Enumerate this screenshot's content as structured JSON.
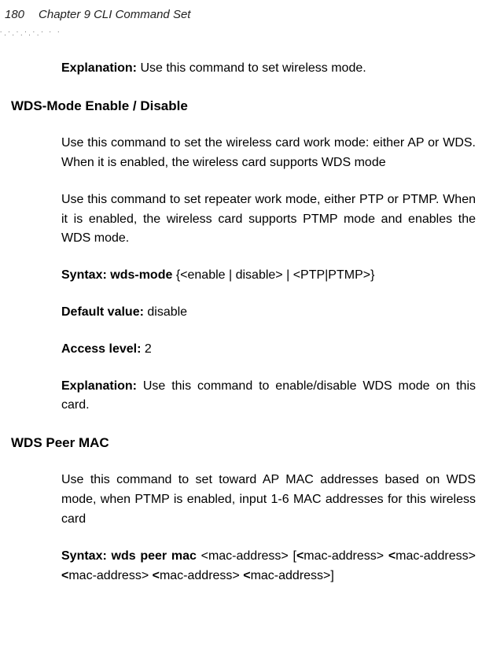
{
  "header": {
    "page_number": "180",
    "chapter": "Chapter 9 CLI Command Set"
  },
  "intro": {
    "explanation_label": "Explanation:",
    "explanation_text": " Use this command to set wireless mode."
  },
  "section1": {
    "title": "WDS-Mode Enable / Disable",
    "para1": "Use this command to set the wireless card work mode: either AP or WDS. When it is enabled, the wireless card supports WDS mode",
    "para2": "Use this command to set repeater work mode, either PTP or PTMP. When it is enabled, the wireless card supports PTMP mode and enables the WDS mode.",
    "syntax_label": "Syntax: wds-mode ",
    "syntax_text": "{<enable | disable> | <PTP|PTMP>}",
    "default_label": "Default value: ",
    "default_text": "disable",
    "access_label": "Access level: ",
    "access_text": "2",
    "explanation_label": "Explanation: ",
    "explanation_text": "Use this command to enable/disable WDS mode on this card."
  },
  "section2": {
    "title": "WDS Peer MAC",
    "para1": "Use this command to set toward AP MAC addresses based on WDS mode, when PTMP is enabled, input 1-6 MAC addresses for this wireless card",
    "syntax_label": "Syntax: wds peer mac ",
    "syntax_text_a": "<mac-address> [",
    "syntax_bold_b": "<",
    "syntax_text_b": "mac-address> ",
    "syntax_bold_c": "<",
    "syntax_text_c": "mac-address> ",
    "syntax_bold_d": "<",
    "syntax_text_d": "mac-address> ",
    "syntax_bold_e": "<",
    "syntax_text_e": "mac-address> ",
    "syntax_bold_f": "<",
    "syntax_text_f": "mac-address>]"
  }
}
